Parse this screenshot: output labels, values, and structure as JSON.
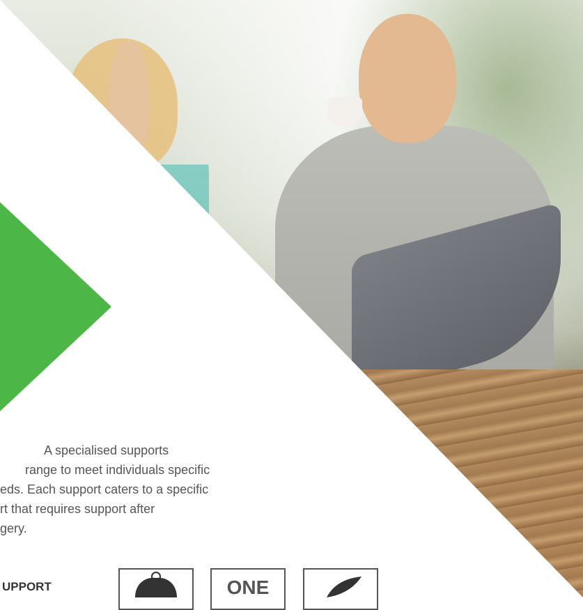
{
  "body_text": {
    "line1": "A specialised supports",
    "line2": "range to meet individuals specific",
    "line3": "eds. Each support caters to a specific",
    "line4": "rt that requires support after",
    "line5": "gery."
  },
  "bottom": {
    "label": "UPPORT",
    "badges": [
      {
        "icon": "muscle-icon",
        "text": ""
      },
      {
        "icon": "one-size-icon",
        "text": "ONE"
      },
      {
        "icon": "leaf-icon",
        "text": ""
      }
    ]
  },
  "colors": {
    "accent": "#4cb646",
    "text": "#555555"
  }
}
